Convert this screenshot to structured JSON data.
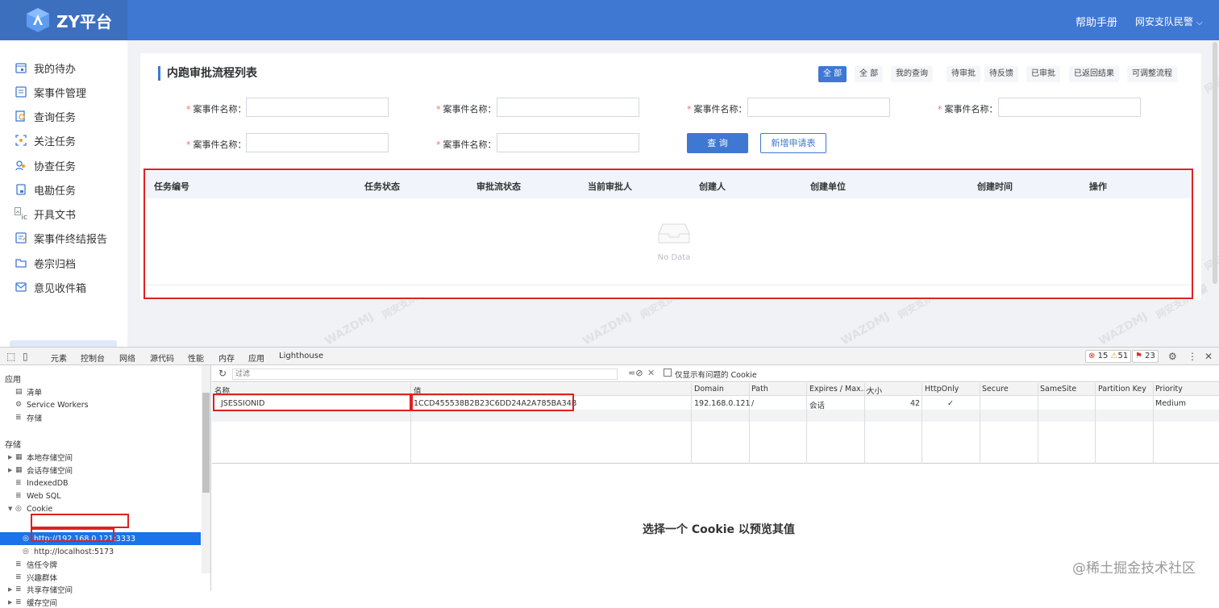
{
  "app": {
    "logo_text": "ZY平台",
    "help_label": "帮助手册",
    "user_label": "网安支队民警"
  },
  "sidebar": {
    "items": [
      {
        "label": "我的待办",
        "icon": "calendar-icon"
      },
      {
        "label": "案事件管理",
        "icon": "list-icon"
      },
      {
        "label": "查询任务",
        "icon": "search-doc-icon"
      },
      {
        "label": "关注任务",
        "icon": "focus-icon"
      },
      {
        "label": "协查任务",
        "icon": "users-icon"
      },
      {
        "label": "电勘任务",
        "icon": "doc-icon"
      },
      {
        "label": "开具文书",
        "icon": "broken-image-icon"
      },
      {
        "label": "案事件终结报告",
        "icon": "report-icon"
      },
      {
        "label": "卷宗归档",
        "icon": "folder-icon"
      },
      {
        "label": "意见收件箱",
        "icon": "mail-icon"
      }
    ],
    "broken_img_alt": "ic"
  },
  "card": {
    "title": "内跑审批流程列表",
    "tabs": [
      {
        "label": "全 部",
        "active": true
      },
      {
        "label": "全 部",
        "active": false
      },
      {
        "label": "我的查询",
        "active": false
      },
      {
        "label": "待审批",
        "active": false
      },
      {
        "label": "待反馈",
        "active": false
      },
      {
        "label": "已审批",
        "active": false
      },
      {
        "label": "已返回结果",
        "active": false
      },
      {
        "label": "可调整流程",
        "active": false
      }
    ],
    "field_label": "案事件名称：",
    "query_label": "查 询",
    "new_label": "新增申请表",
    "columns": [
      "任务编号",
      "任务状态",
      "审批流状态",
      "当前审批人",
      "创建人",
      "创建单位",
      "创建时间",
      "操作"
    ],
    "empty_text": "No Data"
  },
  "watermark": "WAZDMJ",
  "watermark_sub": "网安支队民警",
  "devtools": {
    "tabs": [
      "元素",
      "控制台",
      "网络",
      "源代码",
      "性能",
      "内存",
      "应用",
      "Lighthouse"
    ],
    "active_tab": "应用",
    "errors": "15",
    "warnings": "51",
    "issues": "23",
    "side_app_header": "应用",
    "side_app_items": [
      "清单",
      "Service Workers",
      "存储"
    ],
    "side_storage_header": "存储",
    "side_storage_items": [
      "本地存储空间",
      "会话存储空间",
      "IndexedDB",
      "Web SQL",
      "Cookie",
      "http://192.168.0.121:3333",
      "http://localhost:5173",
      "信任令牌",
      "兴趣群体",
      "共享存储空间",
      "缓存空间"
    ],
    "filter_placeholder": "过滤",
    "only_issue_label": "仅显示有问题的 Cookie",
    "cookie_columns": [
      "名称",
      "值",
      "Domain",
      "Path",
      "Expires / Max...",
      "大小",
      "HttpOnly",
      "Secure",
      "SameSite",
      "Partition Key",
      "Priority"
    ],
    "cookie_row": {
      "name": "JSESSIONID",
      "value": "1CCD455538B2B23C6DD24A2A785BA34B",
      "domain": "192.168.0.121",
      "path": "/",
      "expires": "会话",
      "size": "42",
      "httponly": "✓",
      "priority": "Medium"
    },
    "preview_text": "选择一个 Cookie 以预览其值"
  },
  "footer_watermark": "@稀土掘金技术社区",
  "colors": {
    "brand": "#3f78d3",
    "highlight": "#e02020",
    "selection": "#1a73e8"
  }
}
